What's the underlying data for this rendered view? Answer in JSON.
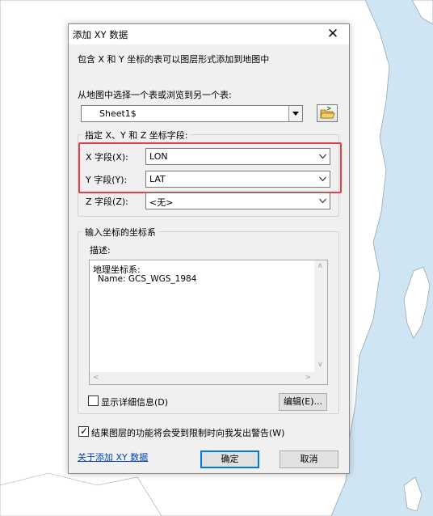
{
  "dialog": {
    "title": "添加 XY 数据",
    "close_symbol": "✕",
    "description": "包含 X 和 Y 坐标的表可以图层形式添加到地图中",
    "table_prompt": "从地图中选择一个表或浏览到另一个表:",
    "table_value": "Sheet1$",
    "fields_group_label": "指定 X、Y 和 Z 坐标字段:",
    "x_field_label": "X 字段(X):",
    "x_field_value": "LON",
    "y_field_label": "Y 字段(Y):",
    "y_field_value": "LAT",
    "z_field_label": "Z 字段(Z):",
    "z_field_value": "<无>",
    "crs_group_label": "输入坐标的坐标系",
    "crs_desc_label": "描述:",
    "crs_line1": "地理坐标系:",
    "crs_line2": "Name: GCS_WGS_1984",
    "show_details_label": "显示详细信息(D)",
    "show_details_checked": false,
    "edit_button": "编辑(E)...",
    "warn_label": "结果图层的功能将会受到限制时向我发出警告(W)",
    "warn_checked": true,
    "about_link": "关于添加 XY 数据",
    "ok_button": "确定",
    "cancel_button": "取消"
  },
  "colors": {
    "highlight": "#e0424b",
    "map_sea": "#cfe5f3",
    "map_land": "#ffffff"
  }
}
